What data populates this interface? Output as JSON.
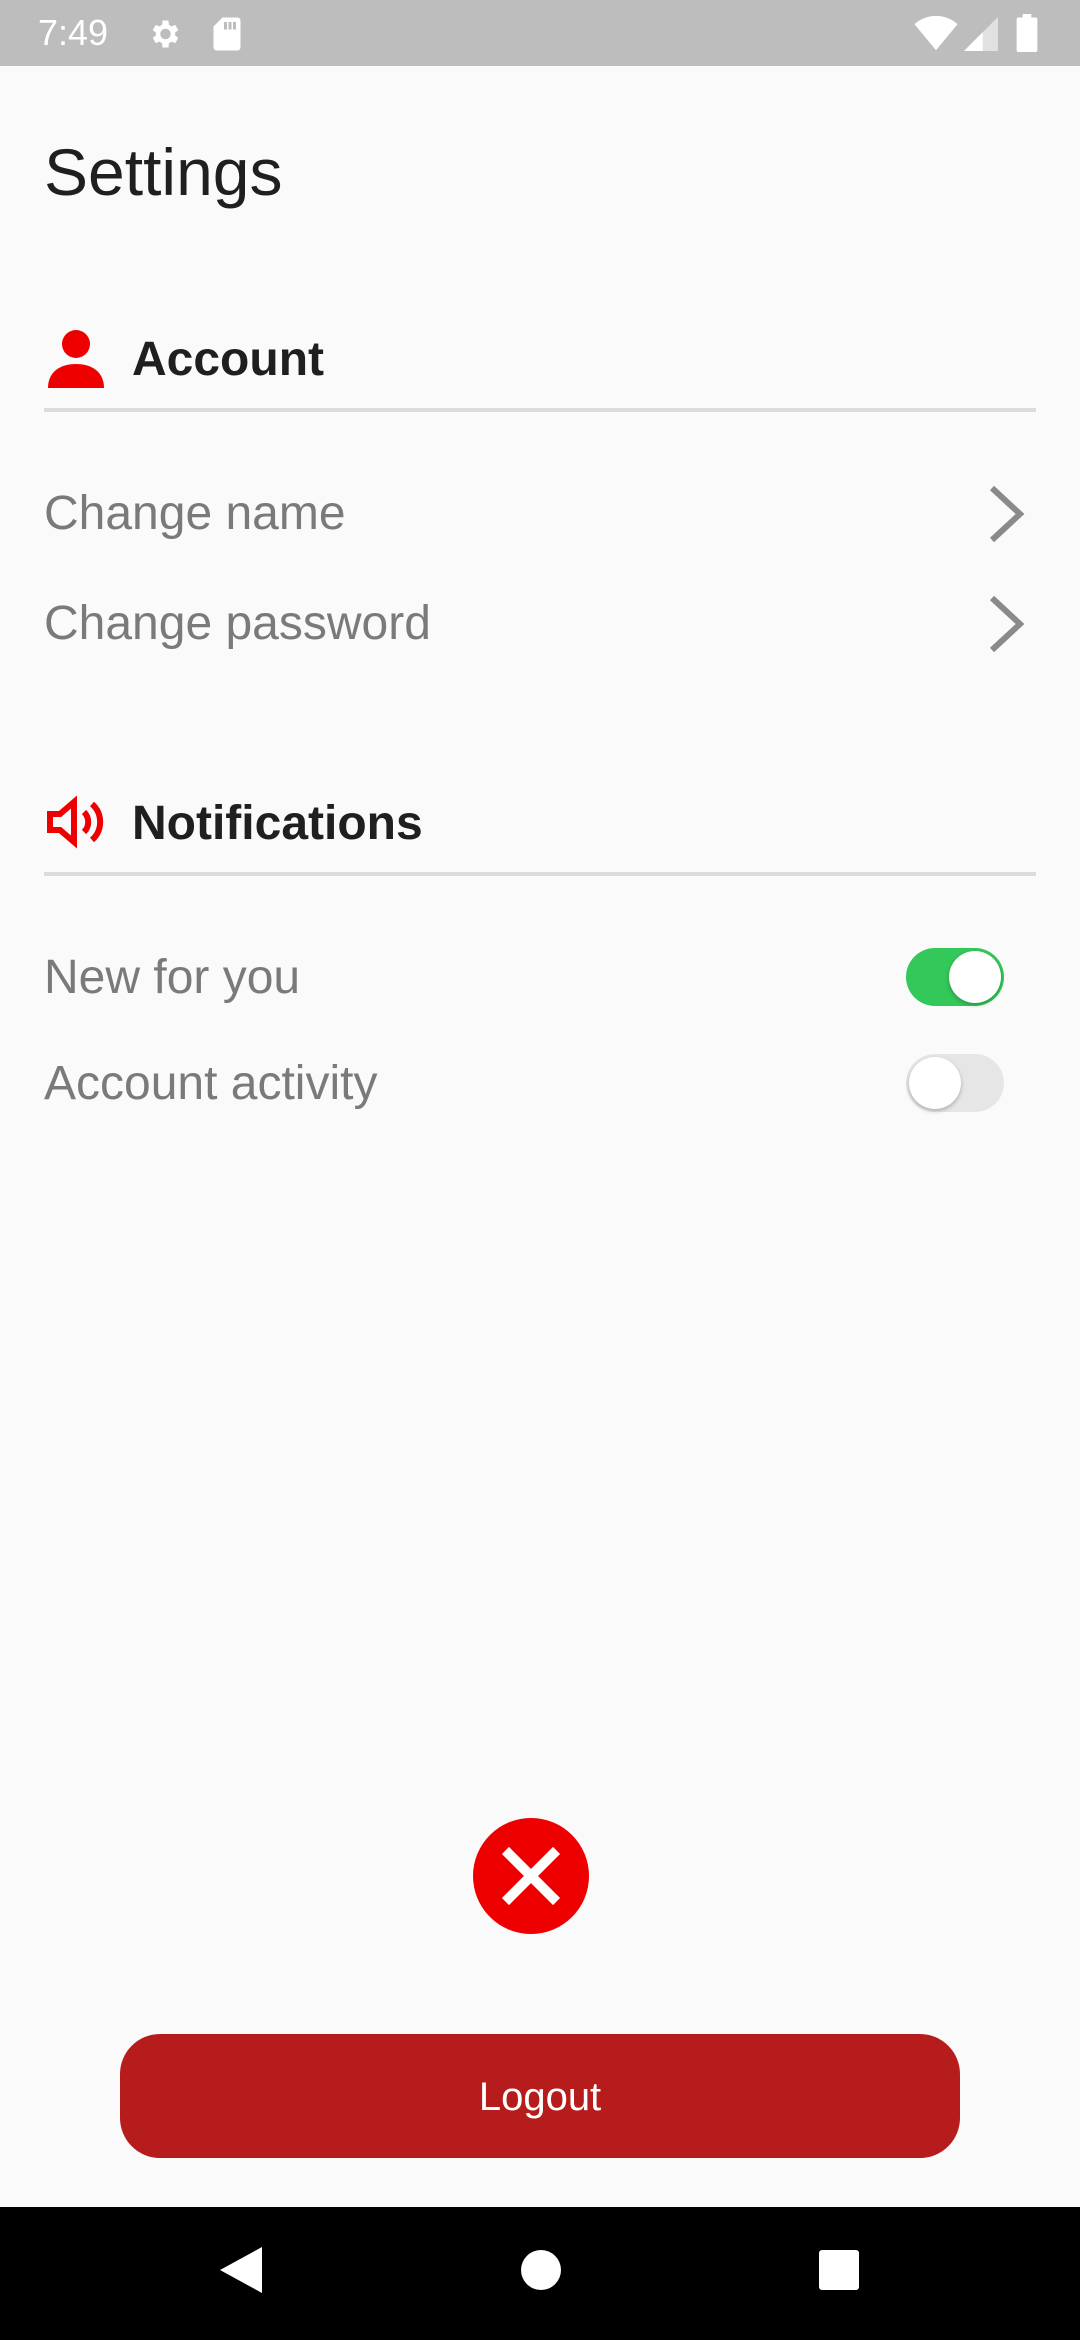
{
  "status_bar": {
    "time": "7:49",
    "icons": [
      "gear-icon",
      "sd-card-icon",
      "wifi-icon",
      "signal-icon",
      "battery-icon"
    ]
  },
  "page": {
    "title": "Settings"
  },
  "account_section": {
    "title": "Account",
    "icon": "person-icon",
    "items": [
      {
        "label": "Change name",
        "icon": "chevron-right-icon"
      },
      {
        "label": "Change password",
        "icon": "chevron-right-icon"
      }
    ]
  },
  "notifications_section": {
    "title": "Notifications",
    "icon": "speaker-icon",
    "items": [
      {
        "label": "New for you",
        "enabled": true
      },
      {
        "label": "Account activity",
        "enabled": false
      }
    ]
  },
  "close_icon": "close-icon",
  "logout": {
    "label": "Logout"
  },
  "colors": {
    "accent": "#ee0000",
    "logout": "#b71c1c",
    "toggle_on": "#34c759",
    "toggle_off": "#e6e6e6",
    "status_bar": "#bdbdbd"
  },
  "nav_bar": {
    "icons": [
      "back-icon",
      "home-icon",
      "recents-icon"
    ]
  }
}
